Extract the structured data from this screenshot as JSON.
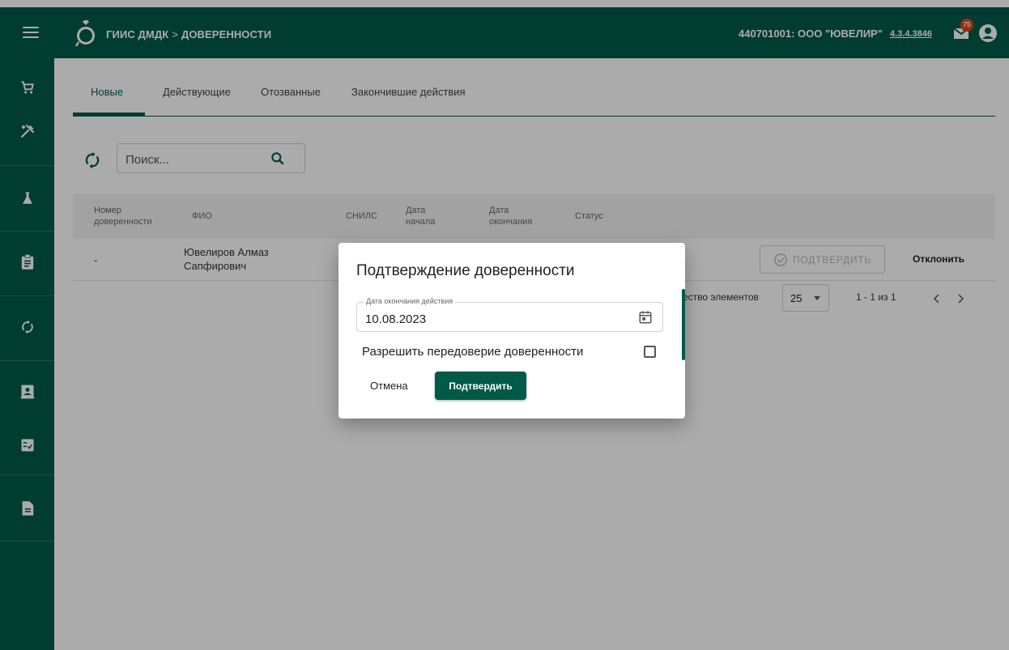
{
  "header": {
    "app_name": "ГИИС ДМДК",
    "separator": ">",
    "section": "ДОВЕРЕННОСТИ",
    "organization": "440701001: ООО \"ЮВЕЛИР\"",
    "version": "4.3.4.3846",
    "notifications_count": "75"
  },
  "sidebar": {
    "icons": [
      "cart-icon",
      "tools-icon",
      "flask-icon",
      "clipboard-icon",
      "sync-icon",
      "contact-card-icon",
      "checklist-icon",
      "document-icon"
    ]
  },
  "tabs": [
    {
      "label": "Новые",
      "active": true
    },
    {
      "label": "Действующие",
      "active": false
    },
    {
      "label": "Отозванные",
      "active": false
    },
    {
      "label": "Закончившие действия",
      "active": false
    }
  ],
  "search": {
    "placeholder": "Поиск..."
  },
  "table": {
    "columns": {
      "number_line1": "Номер",
      "number_line2": "доверенности",
      "fio": "ФИО",
      "snils": "СНИЛС",
      "start_line1": "Дата",
      "start_line2": "начала",
      "end_line1": "Дата",
      "end_line2": "окончания",
      "status": "Статус"
    },
    "rows": [
      {
        "number": "-",
        "fio_line1": "Ювелиров Алмаз",
        "fio_line2": "Сапфирович",
        "confirm_label": "ПОДТВЕРДИТЬ",
        "reject_label": "Отклонить"
      }
    ]
  },
  "pagination": {
    "items_label": "ество элементов",
    "page_size": "25",
    "range": "1 - 1 из 1"
  },
  "dialog": {
    "title": "Подтверждение доверенности",
    "end_date_label": "Дата окончания действия",
    "end_date_value": "10.08.2023",
    "allow_redelegation_label": "Разрешить передоверие доверенности",
    "allow_redelegation_checked": false,
    "cancel_label": "Отмена",
    "confirm_label": "Подтвердить"
  },
  "colors": {
    "brand": "#005a48",
    "badge": "#e0451c"
  }
}
